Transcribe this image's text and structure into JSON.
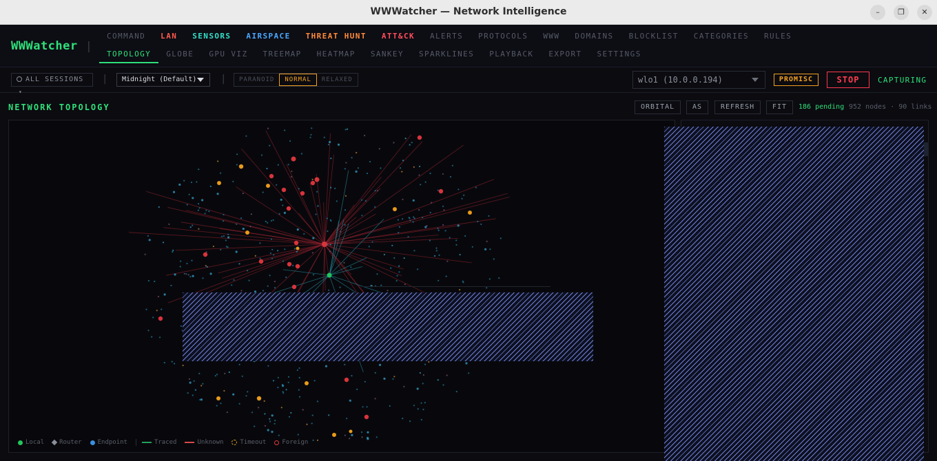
{
  "window": {
    "title": "WWWatcher — Network Intelligence",
    "minimize_glyph": "–",
    "restore_glyph": "❐",
    "close_glyph": "✕"
  },
  "app": {
    "logo": "WWWatcher",
    "separator": "|"
  },
  "nav": {
    "row1": [
      {
        "label": "COMMAND",
        "color": "#555a66"
      },
      {
        "label": "LAN",
        "color": "#ff5a4d"
      },
      {
        "label": "SENSORS",
        "color": "#33e0c8"
      },
      {
        "label": "AIRSPACE",
        "color": "#4aa8ff"
      },
      {
        "label": "THREAT HUNT",
        "color": "#ff8c3a"
      },
      {
        "label": "ATT&CK",
        "color": "#ff4d5a"
      },
      {
        "label": "ALERTS",
        "color": "#555a66"
      },
      {
        "label": "PROTOCOLS",
        "color": "#555a66"
      },
      {
        "label": "WWW",
        "color": "#555a66"
      },
      {
        "label": "DOMAINS",
        "color": "#555a66"
      },
      {
        "label": "BLOCKLIST",
        "color": "#555a66"
      },
      {
        "label": "CATEGORIES",
        "color": "#555a66"
      },
      {
        "label": "RULES",
        "color": "#555a66"
      }
    ],
    "row2": [
      {
        "label": "TOPOLOGY",
        "active": true
      },
      {
        "label": "GLOBE"
      },
      {
        "label": "GPU VIZ"
      },
      {
        "label": "TREEMAP"
      },
      {
        "label": "HEATMAP"
      },
      {
        "label": "SANKEY"
      },
      {
        "label": "SPARKLINES"
      },
      {
        "label": "PLAYBACK"
      },
      {
        "label": "EXPORT"
      },
      {
        "label": "SETTINGS"
      }
    ]
  },
  "toolbar": {
    "sessions_label": "ALL SESSIONS",
    "sessions_caret": "▾",
    "theme_value": "Midnight (Default)",
    "sep": "|",
    "modes": [
      {
        "label": "PARANOID",
        "active": false
      },
      {
        "label": "NORMAL",
        "active": true
      },
      {
        "label": "RELAXED",
        "active": false
      }
    ],
    "interface_value": "wlo1 (10.0.0.194)",
    "promisc_label": "PROMISC",
    "stop_label": "STOP",
    "status_label": "CAPTURING"
  },
  "topology": {
    "title": "NETWORK TOPOLOGY",
    "buttons": {
      "orbital": "ORBITAL",
      "as": "AS",
      "refresh": "REFRESH",
      "fit": "FIT"
    },
    "pending": "186 pending",
    "stats": "952 nodes · 90 links",
    "legend": [
      {
        "label": "Local",
        "kind": "dot",
        "color": "#22c55e"
      },
      {
        "label": "Router",
        "kind": "diamond",
        "color": "#8a8f9a"
      },
      {
        "label": "Endpoint",
        "kind": "dot",
        "color": "#3b8fe0"
      },
      {
        "label": "Traced",
        "kind": "line",
        "color": "#22a05a"
      },
      {
        "label": "Unknown",
        "kind": "line",
        "color": "#d94a4a"
      },
      {
        "label": "Timeout",
        "kind": "dash",
        "color": "#e0a020"
      },
      {
        "label": "Foreign",
        "kind": "ring",
        "color": "#e03a3a"
      }
    ]
  },
  "colors": {
    "accent": "#2fe07a",
    "warning": "#f2a020",
    "danger": "#ff3b4f",
    "node_red": "#e0373f",
    "node_orange": "#e89a1a",
    "node_cyan": "#2a8fb0",
    "link_red": "#8a1f2a"
  }
}
